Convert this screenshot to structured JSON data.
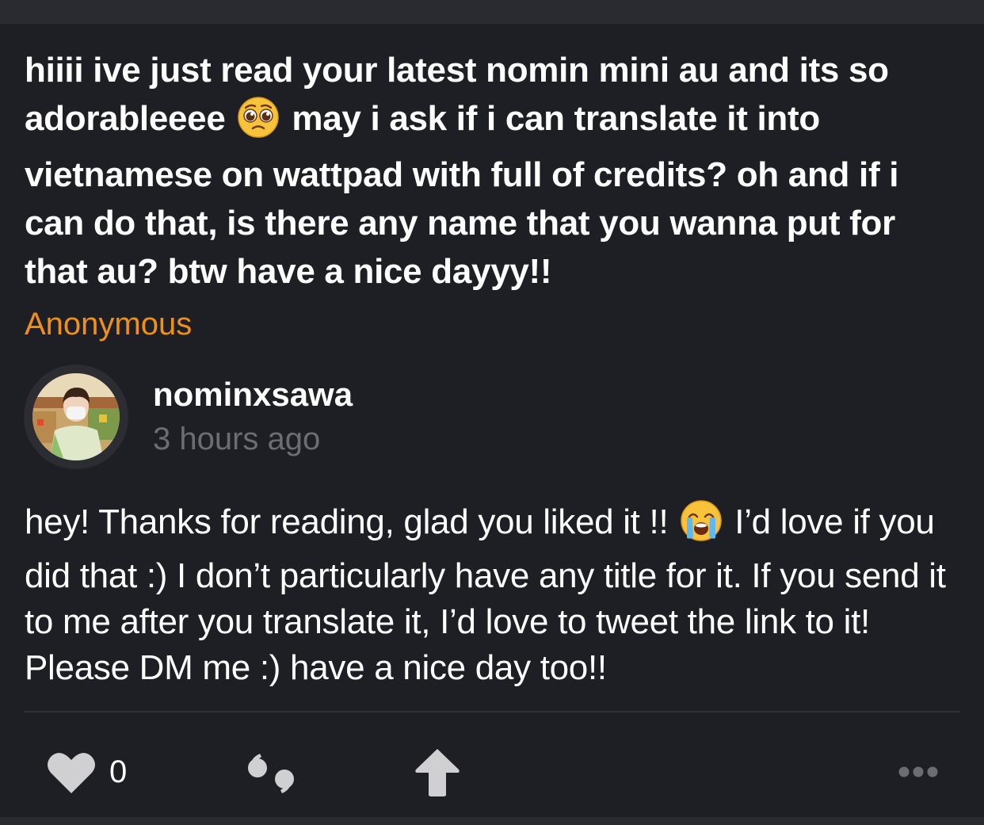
{
  "question": {
    "text_before_emoji": "hiiii ive just read your latest nomin mini au and its so adorableeee",
    "emoji": "pleading-face-emoji",
    "text_after_emoji": "may i ask if i can translate it into vietnamese on wattpad with full of credits? oh and if i can do that, is there any name that you wanna put for that au? btw have a nice dayyy!!"
  },
  "asker": "Anonymous",
  "answerer": {
    "username": "nominxsawa",
    "time": "3 hours ago",
    "avatar": "profile-photo"
  },
  "answer": {
    "text_before_emoji": "hey! Thanks for reading, glad you liked it !!",
    "emoji": "crying-face-emoji",
    "text_after_emoji": "I’d love if you did that :) I don’t particularly have any title for it. If you send it to me after you translate it, I’d love to tweet the link to it! Please DM me :) have a nice day too!!"
  },
  "actions": {
    "like_count": "0",
    "like_icon": "heart-icon",
    "reask_icon": "quote-icon",
    "share_icon": "share-arrow-icon",
    "more_icon": "more-dots-icon"
  },
  "colors": {
    "background": "#1e1f24",
    "asker": "#f0901a",
    "muted": "#6c6d72",
    "icon": "#d0d0d3"
  }
}
